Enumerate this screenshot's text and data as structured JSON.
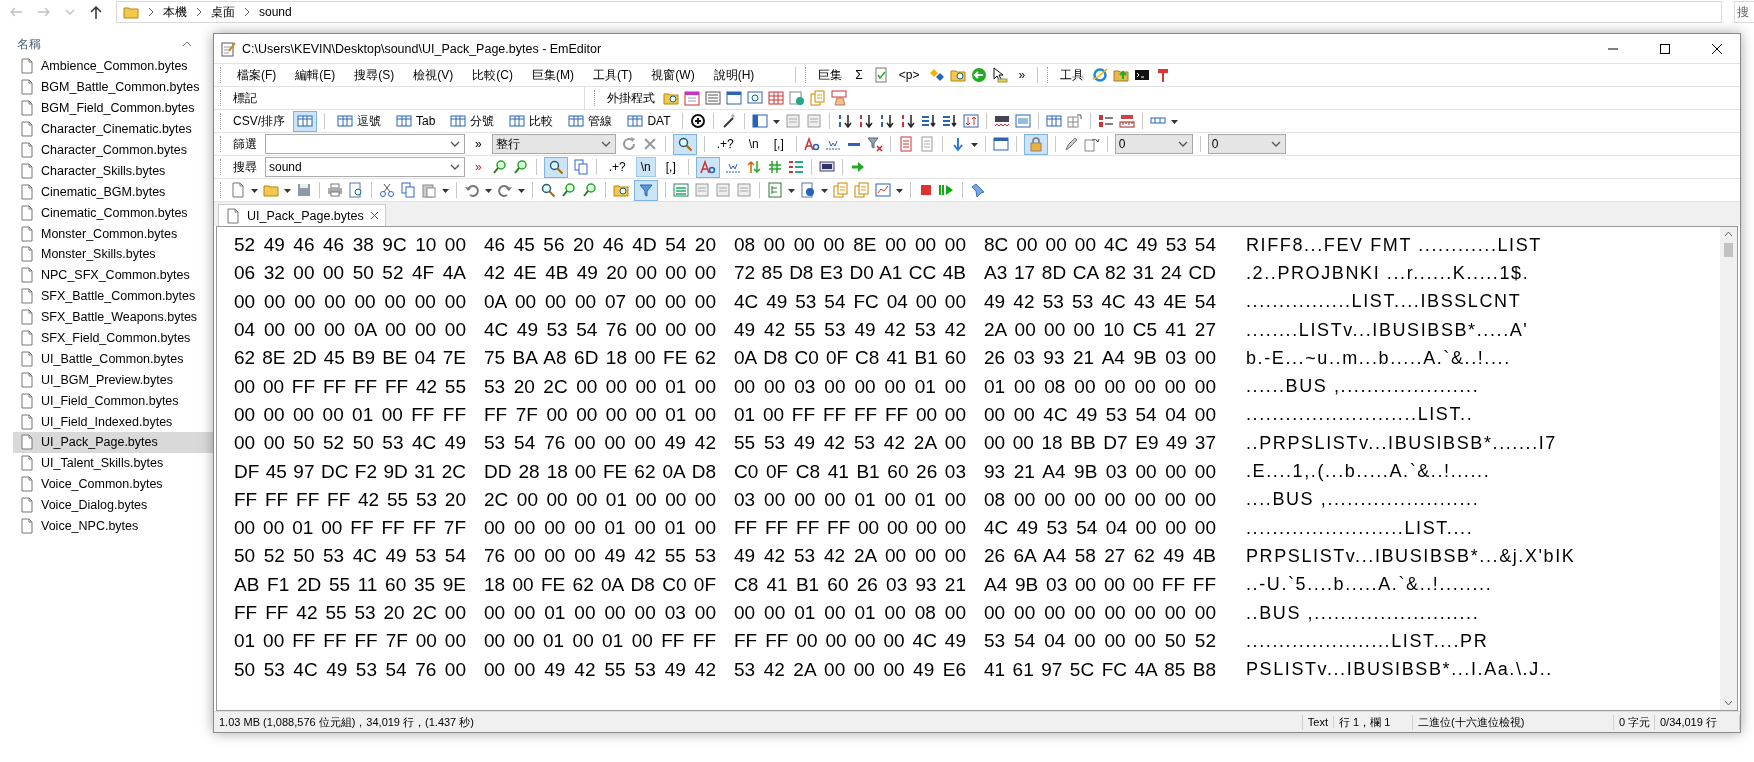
{
  "explorer": {
    "breadcrumbs": [
      "本機",
      "桌面",
      "sound"
    ],
    "search_placeholder": "搜",
    "column_header": "名稱",
    "files": [
      {
        "name": "Ambience_Common.bytes",
        "selected": false
      },
      {
        "name": "BGM_Battle_Common.bytes",
        "selected": false
      },
      {
        "name": "BGM_Field_Common.bytes",
        "selected": false
      },
      {
        "name": "Character_Cinematic.bytes",
        "selected": false
      },
      {
        "name": "Character_Common.bytes",
        "selected": false
      },
      {
        "name": "Character_Skills.bytes",
        "selected": false
      },
      {
        "name": "Cinematic_BGM.bytes",
        "selected": false
      },
      {
        "name": "Cinematic_Common.bytes",
        "selected": false
      },
      {
        "name": "Monster_Common.bytes",
        "selected": false
      },
      {
        "name": "Monster_Skills.bytes",
        "selected": false
      },
      {
        "name": "NPC_SFX_Common.bytes",
        "selected": false
      },
      {
        "name": "SFX_Battle_Common.bytes",
        "selected": false
      },
      {
        "name": "SFX_Battle_Weapons.bytes",
        "selected": false
      },
      {
        "name": "SFX_Field_Common.bytes",
        "selected": false
      },
      {
        "name": "UI_Battle_Common.bytes",
        "selected": false
      },
      {
        "name": "UI_BGM_Preview.bytes",
        "selected": false
      },
      {
        "name": "UI_Field_Common.bytes",
        "selected": false
      },
      {
        "name": "UI_Field_Indexed.bytes",
        "selected": false
      },
      {
        "name": "UI_Pack_Page.bytes",
        "selected": true
      },
      {
        "name": "UI_Talent_Skills.bytes",
        "selected": false
      },
      {
        "name": "Voice_Common.bytes",
        "selected": false
      },
      {
        "name": "Voice_Dialog.bytes",
        "selected": false
      },
      {
        "name": "Voice_NPC.bytes",
        "selected": false
      }
    ]
  },
  "editor": {
    "title": "C:\\Users\\KEVIN\\Desktop\\sound\\UI_Pack_Page.bytes - EmEditor",
    "menus": [
      "檔案(F)",
      "編輯(E)",
      "搜尋(S)",
      "檢視(V)",
      "比較(C)",
      "巨集(M)",
      "工具(T)",
      "視窗(W)",
      "說明(H)"
    ],
    "macro_toolbar": {
      "label": "巨集",
      "sum": "Σ",
      "tag": "<p>",
      "more": "»"
    },
    "tools_toolbar": {
      "label": "工具"
    },
    "bookmark_label": "標記",
    "plugins_toolbar": {
      "label": "外掛程式"
    },
    "csv_toolbar": {
      "label": "CSV/排序",
      "grid_pressed": true,
      "formats": [
        "逗號",
        "Tab",
        "分號",
        "比較",
        "管線",
        "DAT"
      ]
    },
    "filter_bar": {
      "label": "篩選",
      "more": "»",
      "scope": "整行",
      "find_pressed": true,
      "regex": ".+?",
      "escape": "\\n",
      "list": "[,]",
      "lock_pressed": true,
      "before": "0",
      "after": "0"
    },
    "search_bar": {
      "label": "搜尋",
      "value": "sound",
      "more": "»",
      "highlight_pressed": true,
      "regex": ".+?",
      "escape": "\\n",
      "escape_pressed": true,
      "list": "[,]",
      "case_pressed": true
    },
    "standard_toolbar": {
      "filter_pressed": true
    },
    "tabs": [
      {
        "label": "UI_Pack_Page.bytes",
        "selected": true
      }
    ],
    "hex_rows": [
      {
        "groups": [
          "52 49 46 46 38 9C 10 00",
          "46 45 56 20 46 4D 54 20",
          "08 00 00 00 8E 00 00 00",
          "8C 00 00 00 4C 49 53 54"
        ],
        "text": "RIFF8...FEV FMT ............LIST"
      },
      {
        "groups": [
          "06 32 00 00 50 52 4F 4A",
          "42 4E 4B 49 20 00 00 00",
          "72 85 D8 E3 D0 A1 CC 4B",
          "A3 17 8D CA 82 31 24 CD"
        ],
        "text": ".2..PROJBNKI ...r......K.....1$."
      },
      {
        "groups": [
          "00 00 00 00 00 00 00 00",
          "0A 00 00 00 07 00 00 00",
          "4C 49 53 54 FC 04 00 00",
          "49 42 53 53 4C 43 4E 54"
        ],
        "text": "................LIST....IBSSLCNT"
      },
      {
        "groups": [
          "04 00 00 00 0A 00 00 00",
          "4C 49 53 54 76 00 00 00",
          "49 42 55 53 49 42 53 42",
          "2A 00 00 00 10 C5 41 27"
        ],
        "text": "........LISTv...IBUSIBSB*.....A'"
      },
      {
        "groups": [
          "62 8E 2D 45 B9 BE 04 7E",
          "75 BA A8 6D 18 00 FE 62",
          "0A D8 C0 0F C8 41 B1 60",
          "26 03 93 21 A4 9B 03 00"
        ],
        "text": "b.-E...~u..m...b.....A.`&..!...."
      },
      {
        "groups": [
          "00 00 FF FF FF FF 42 55",
          "53 20 2C 00 00 00 01 00",
          "00 00 03 00 00 00 01 00",
          "01 00 08 00 00 00 00 00"
        ],
        "text": "......BUS ,....................."
      },
      {
        "groups": [
          "00 00 00 00 01 00 FF FF",
          "FF 7F 00 00 00 00 01 00",
          "01 00 FF FF FF FF 00 00",
          "00 00 4C 49 53 54 04 00"
        ],
        "text": "..........................LIST.."
      },
      {
        "groups": [
          "00 00 50 52 50 53 4C 49",
          "53 54 76 00 00 00 49 42",
          "55 53 49 42 53 42 2A 00",
          "00 00 18 BB D7 E9 49 37"
        ],
        "text": "..PRPSLISTv...IBUSIBSB*.......I7"
      },
      {
        "groups": [
          "DF 45 97 DC F2 9D 31 2C",
          "DD 28 18 00 FE 62 0A D8",
          "C0 0F C8 41 B1 60 26 03",
          "93 21 A4 9B 03 00 00 00"
        ],
        "text": ".E....1,.(...b.....A.`&..!......"
      },
      {
        "groups": [
          "FF FF FF FF 42 55 53 20",
          "2C 00 00 00 01 00 00 00",
          "03 00 00 00 01 00 01 00",
          "08 00 00 00 00 00 00 00"
        ],
        "text": "....BUS ,......................."
      },
      {
        "groups": [
          "00 00 01 00 FF FF FF 7F",
          "00 00 00 00 01 00 01 00",
          "FF FF FF FF 00 00 00 00",
          "4C 49 53 54 04 00 00 00"
        ],
        "text": "........................LIST...."
      },
      {
        "groups": [
          "50 52 50 53 4C 49 53 54",
          "76 00 00 00 49 42 55 53",
          "49 42 53 42 2A 00 00 00",
          "26 6A A4 58 27 62 49 4B"
        ],
        "text": "PRPSLISTv...IBUSIBSB*...&j.X'bIK"
      },
      {
        "groups": [
          "AB F1 2D 55 11 60 35 9E",
          "18 00 FE 62 0A D8 C0 0F",
          "C8 41 B1 60 26 03 93 21",
          "A4 9B 03 00 00 00 FF FF"
        ],
        "text": "..-U.`5....b.....A.`&..!........"
      },
      {
        "groups": [
          "FF FF 42 55 53 20 2C 00",
          "00 00 01 00 00 00 03 00",
          "00 00 01 00 01 00 08 00",
          "00 00 00 00 00 00 00 00"
        ],
        "text": "..BUS ,........................."
      },
      {
        "groups": [
          "01 00 FF FF FF 7F 00 00",
          "00 00 01 00 01 00 FF FF",
          "FF FF 00 00 00 00 4C 49",
          "53 54 04 00 00 00 50 52"
        ],
        "text": "......................LIST....PR"
      },
      {
        "groups": [
          "50 53 4C 49 53 54 76 00",
          "00 00 49 42 55 53 49 42",
          "53 42 2A 00 00 00 49 E6",
          "41 61 97 5C FC 4A 85 B8"
        ],
        "text": "PSLISTv...IBUSIBSB*...I.Aa.\\.J.."
      }
    ],
    "status_bar": {
      "summary": "1.03 MB (1,088,576 位元組)，34,019 行，(1.437 秒)",
      "syntax": "Text",
      "position": "行 1，欄 1",
      "mode": "二進位(十六進位檢視)",
      "selection": "0 字元",
      "lines": "0/34,019 行"
    }
  }
}
